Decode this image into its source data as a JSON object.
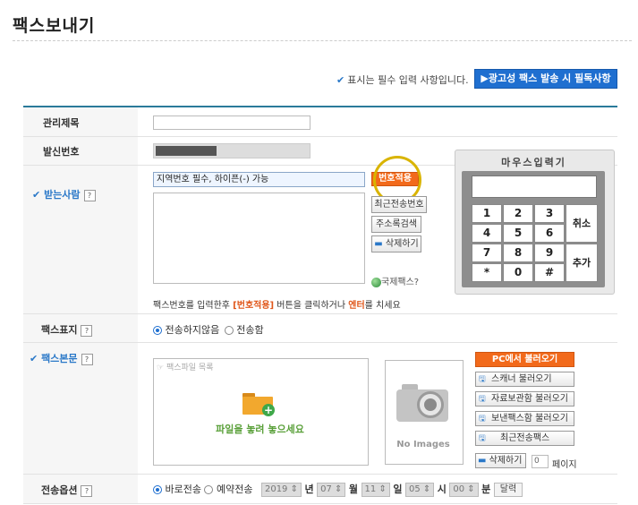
{
  "page": {
    "title": "팩스보내기"
  },
  "notice": {
    "required_note": "표시는 필수 입력 사항입니다.",
    "ad_button": "▶광고성 팩스 발송 시 필독사항"
  },
  "fields": {
    "subject": {
      "label": "관리제목",
      "value": ""
    },
    "sender": {
      "label": "발신번호"
    },
    "recipient": {
      "label": "받는사람",
      "help": "?",
      "input_value": "지역번호 필수, 하이픈(-) 가능",
      "apply_button": "번호적용",
      "btn_recent": "최근전송번호",
      "btn_address": "주소록검색",
      "btn_delete": "삭제하기",
      "intl_fax": "국제팩스?",
      "hint_pre": "팩스번호를 입력한후 ",
      "hint_btn": "[번호적용]",
      "hint_mid": " 버튼을 클릭하거나 ",
      "hint_enter": "엔터",
      "hint_post": "를 치세요"
    },
    "cover": {
      "label": "팩스표지",
      "help": "?",
      "opt_no": "전송하지않음",
      "opt_yes": "전송함"
    },
    "body": {
      "label": "팩스본문",
      "help": "?",
      "file_list_placeholder": "팩스파일 목록",
      "drop_text": "파일을 놓려 놓으세요",
      "no_images": "No Images",
      "btn_pc": "PC에서 불러오기",
      "btn_scanner": "스캐너 불러오기",
      "btn_archive": "자료보관함 불러오기",
      "btn_sent": "보낸팩스함 불러오기",
      "btn_recent": "최근전송팩스",
      "btn_delete": "삭제하기",
      "page_value": "0",
      "page_label": "페이지"
    },
    "send_option": {
      "label": "전송옵션",
      "help": "?",
      "opt_now": "바로전송",
      "opt_reserve": "예약전송",
      "year": "2019",
      "year_unit": "년",
      "month": "07",
      "month_unit": "월",
      "day": "11",
      "day_unit": "일",
      "hour": "05",
      "hour_unit": "시",
      "minute": "00",
      "minute_unit": "분",
      "calendar": "달력"
    }
  },
  "keypad": {
    "title": "마우스입력기",
    "keys": [
      "1",
      "2",
      "3",
      "4",
      "5",
      "6",
      "7",
      "8",
      "9",
      "*",
      "0",
      "#"
    ],
    "cancel": "취소",
    "add": "추가"
  },
  "colors": {
    "accent": "#1f6fd0",
    "orange": "#f26a1b",
    "highlight_ring": "#d9b400"
  }
}
